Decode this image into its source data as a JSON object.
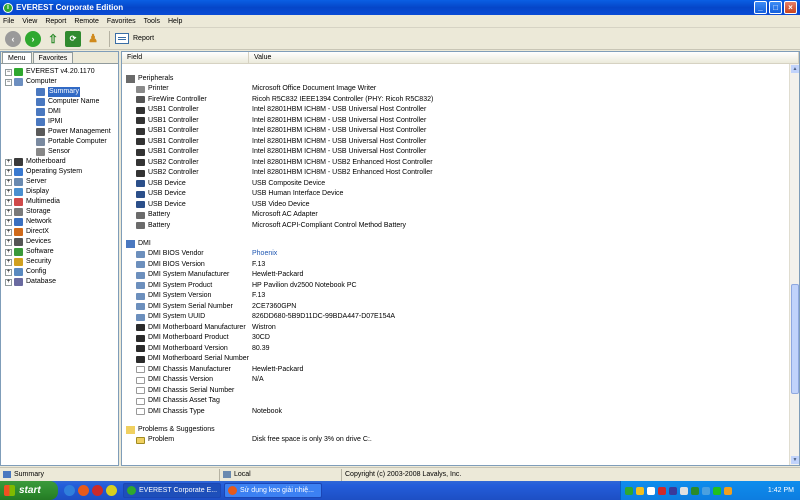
{
  "window": {
    "title": "EVEREST Corporate Edition"
  },
  "menu": [
    "File",
    "View",
    "Report",
    "Remote",
    "Favorites",
    "Tools",
    "Help"
  ],
  "toolbar": {
    "report_label": "Report"
  },
  "left_tabs": [
    "Menu",
    "Favorites"
  ],
  "tree": [
    {
      "label": "EVEREST v4.20.1170",
      "level": 1,
      "exp": "−",
      "color": "#2fa82f",
      "selected": false
    },
    {
      "label": "Computer",
      "level": 1,
      "exp": "−",
      "color": "#6d8fc0",
      "selected": false
    },
    {
      "label": "Summary",
      "level": 3,
      "exp": "",
      "color": "#4a78c0",
      "selected": true
    },
    {
      "label": "Computer Name",
      "level": 3,
      "exp": "",
      "color": "#4a78c0",
      "selected": false
    },
    {
      "label": "DMI",
      "level": 3,
      "exp": "",
      "color": "#4a78c0",
      "selected": false
    },
    {
      "label": "IPMI",
      "level": 3,
      "exp": "",
      "color": "#4a78c0",
      "selected": false
    },
    {
      "label": "Power Management",
      "level": 3,
      "exp": "",
      "color": "#5a5a5a",
      "selected": false
    },
    {
      "label": "Portable Computer",
      "level": 3,
      "exp": "",
      "color": "#7a8aa0",
      "selected": false
    },
    {
      "label": "Sensor",
      "level": 3,
      "exp": "",
      "color": "#888888",
      "selected": false
    },
    {
      "label": "Motherboard",
      "level": 1,
      "exp": "+",
      "color": "#3a3a3a",
      "selected": false
    },
    {
      "label": "Operating System",
      "level": 1,
      "exp": "+",
      "color": "#3a7ad0",
      "selected": false
    },
    {
      "label": "Server",
      "level": 1,
      "exp": "+",
      "color": "#6a8ab0",
      "selected": false
    },
    {
      "label": "Display",
      "level": 1,
      "exp": "+",
      "color": "#4a90d0",
      "selected": false
    },
    {
      "label": "Multimedia",
      "level": 1,
      "exp": "+",
      "color": "#d04a4a",
      "selected": false
    },
    {
      "label": "Storage",
      "level": 1,
      "exp": "+",
      "color": "#7a7a7a",
      "selected": false
    },
    {
      "label": "Network",
      "level": 1,
      "exp": "+",
      "color": "#3a70c0",
      "selected": false
    },
    {
      "label": "DirectX",
      "level": 1,
      "exp": "+",
      "color": "#d06a1a",
      "selected": false
    },
    {
      "label": "Devices",
      "level": 1,
      "exp": "+",
      "color": "#555555",
      "selected": false
    },
    {
      "label": "Software",
      "level": 1,
      "exp": "+",
      "color": "#3a9a3a",
      "selected": false
    },
    {
      "label": "Security",
      "level": 1,
      "exp": "+",
      "color": "#d0a020",
      "selected": false
    },
    {
      "label": "Config",
      "level": 1,
      "exp": "+",
      "color": "#5a8ac0",
      "selected": false
    },
    {
      "label": "Database",
      "level": 1,
      "exp": "+",
      "color": "#6a6aa0",
      "selected": false
    }
  ],
  "columns": {
    "field": "Field",
    "value": "Value"
  },
  "sections": [
    {
      "title": "Peripherals",
      "rows": [
        {
          "field": "Printer",
          "value": "Microsoft Office Document Image Writer",
          "icon": "printer"
        },
        {
          "field": "FireWire Controller",
          "value": "Ricoh R5C832 IEEE1394 Controller (PHY: Ricoh R5C832)",
          "icon": "fw"
        },
        {
          "field": "USB1 Controller",
          "value": "Intel 82801HBM ICH8M - USB Universal Host Controller",
          "icon": "usb"
        },
        {
          "field": "USB1 Controller",
          "value": "Intel 82801HBM ICH8M - USB Universal Host Controller",
          "icon": "usb"
        },
        {
          "field": "USB1 Controller",
          "value": "Intel 82801HBM ICH8M - USB Universal Host Controller",
          "icon": "usb"
        },
        {
          "field": "USB1 Controller",
          "value": "Intel 82801HBM ICH8M - USB Universal Host Controller",
          "icon": "usb"
        },
        {
          "field": "USB1 Controller",
          "value": "Intel 82801HBM ICH8M - USB Universal Host Controller",
          "icon": "usb"
        },
        {
          "field": "USB2 Controller",
          "value": "Intel 82801HBM ICH8M - USB2 Enhanced Host Controller",
          "icon": "usb"
        },
        {
          "field": "USB2 Controller",
          "value": "Intel 82801HBM ICH8M - USB2 Enhanced Host Controller",
          "icon": "usb"
        },
        {
          "field": "USB Device",
          "value": "USB Composite Device",
          "icon": "dev"
        },
        {
          "field": "USB Device",
          "value": "USB Human Interface Device",
          "icon": "dev"
        },
        {
          "field": "USB Device",
          "value": "USB Video Device",
          "icon": "dev"
        },
        {
          "field": "Battery",
          "value": "Microsoft AC Adapter",
          "icon": "bat"
        },
        {
          "field": "Battery",
          "value": "Microsoft ACPI-Compliant Control Method Battery",
          "icon": "bat"
        }
      ]
    },
    {
      "title": "DMI",
      "rows": [
        {
          "field": "DMI BIOS Vendor",
          "value": "Phoenix",
          "icon": "dmi",
          "link": true
        },
        {
          "field": "DMI BIOS Version",
          "value": "F.13",
          "icon": "dmi"
        },
        {
          "field": "DMI System Manufacturer",
          "value": "Hewlett-Packard",
          "icon": "dmi"
        },
        {
          "field": "DMI System Product",
          "value": "HP Pavilion dv2500 Notebook PC",
          "icon": "dmi"
        },
        {
          "field": "DMI System Version",
          "value": "F.13",
          "icon": "dmi"
        },
        {
          "field": "DMI System Serial Number",
          "value": "2CE7360GPN",
          "icon": "dmi"
        },
        {
          "field": "DMI System UUID",
          "value": "826DD680-5B9D11DC-99BDA447-D07E154A",
          "icon": "dmi"
        },
        {
          "field": "DMI Motherboard Manufacturer",
          "value": "Wistron",
          "icon": "mb"
        },
        {
          "field": "DMI Motherboard Product",
          "value": "30CD",
          "icon": "mb"
        },
        {
          "field": "DMI Motherboard Version",
          "value": "80.39",
          "icon": "mb"
        },
        {
          "field": "DMI Motherboard Serial Number",
          "value": "",
          "icon": "mb"
        },
        {
          "field": "DMI Chassis Manufacturer",
          "value": "Hewlett-Packard",
          "icon": "chassis"
        },
        {
          "field": "DMI Chassis Version",
          "value": "N/A",
          "icon": "chassis"
        },
        {
          "field": "DMI Chassis Serial Number",
          "value": "",
          "icon": "chassis"
        },
        {
          "field": "DMI Chassis Asset Tag",
          "value": "",
          "icon": "chassis"
        },
        {
          "field": "DMI Chassis Type",
          "value": "Notebook",
          "icon": "chassis"
        }
      ]
    },
    {
      "title": "Problems & Suggestions",
      "rows": [
        {
          "field": "Problem",
          "value": "Disk free space is only 3% on drive C:.",
          "icon": "problem"
        }
      ]
    }
  ],
  "status": {
    "left": "Summary",
    "middle": "Local",
    "right": "Copyright (c) 2003-2008 Lavalys, Inc."
  },
  "taskbar": {
    "start": "start",
    "tasks": [
      {
        "label": "EVEREST Corporate E...",
        "active": true
      },
      {
        "label": "Sử dụng keo giải nhiệ...",
        "active": false
      }
    ],
    "clock": "1:42 PM"
  }
}
